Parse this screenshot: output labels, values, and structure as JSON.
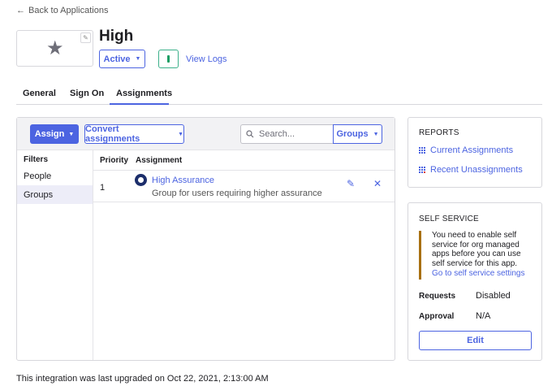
{
  "back_link": {
    "arrow": "←",
    "label": "Back to Applications"
  },
  "app": {
    "logo_icon": "star-icon",
    "logo_glyph": "★",
    "edit_glyph": "✎",
    "title": "High",
    "status_label": "Active",
    "status_caret": "▼",
    "view_logs_label": "View Logs"
  },
  "tabs": [
    {
      "label": "General"
    },
    {
      "label": "Sign On"
    },
    {
      "label": "Assignments",
      "active": true
    }
  ],
  "toolbar": {
    "assign_label": "Assign",
    "convert_label": "Convert assignments",
    "caret": "▼",
    "search_placeholder": "Search...",
    "search_icon": "○",
    "groups_label": "Groups"
  },
  "filters": {
    "title": "Filters",
    "items": [
      {
        "label": "People"
      },
      {
        "label": "Groups",
        "active": true
      }
    ]
  },
  "table": {
    "headers": [
      "Priority",
      "Assignment"
    ],
    "rows": [
      {
        "priority": "1",
        "name": "High Assurance",
        "description": "Group for users requiring higher assurance",
        "edit_glyph": "✎",
        "remove_glyph": "✕"
      }
    ]
  },
  "reports": {
    "title": "REPORTS",
    "links": [
      {
        "label": "Current Assignments",
        "icon": "report-grid-icon"
      },
      {
        "label": "Recent Unassignments",
        "icon": "report-grid-remove-icon"
      }
    ]
  },
  "self_service": {
    "title": "SELF SERVICE",
    "message": "You need to enable self service for org managed apps before you can use self service for this app.",
    "link_label": "Go to self service settings",
    "requests_label": "Requests",
    "requests_value": "Disabled",
    "approval_label": "Approval",
    "approval_value": "N/A",
    "edit_label": "Edit"
  },
  "footer": "This integration was last upgraded on Oct 22, 2021, 2:13:00 AM",
  "colors": {
    "accent": "#4c64e1",
    "success": "#1a9e64",
    "warning": "#a8700f",
    "danger": "#d93934"
  }
}
